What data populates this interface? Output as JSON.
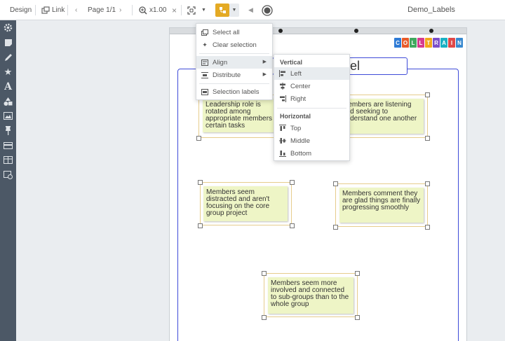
{
  "toolbar": {
    "design_label": "Design",
    "link_label": "Link",
    "page_label": "Page 1/1",
    "zoom_label": "x1.00",
    "doc_title": "Demo_Labels"
  },
  "sidebar": {
    "icons": [
      "gear-icon",
      "note-icon",
      "pen-icon",
      "star-icon",
      "text-icon",
      "shapes-icon",
      "image-icon",
      "pin-icon",
      "card-icon",
      "table-icon",
      "widget-icon"
    ]
  },
  "canvas": {
    "title_fragment": "del",
    "logo_letters": [
      "C",
      "O",
      "L",
      "L",
      "T",
      "R",
      "A",
      "I",
      "N"
    ],
    "logo_colors": [
      "#2e7bd6",
      "#e85b2a",
      "#41a85f",
      "#d63b8f",
      "#f2a81d",
      "#7b4fc9",
      "#1ab0c4",
      "#e04848",
      "#3a8ad0"
    ],
    "notes": [
      {
        "text": "Leadership role is rotated among appropriate members for certain tasks"
      },
      {
        "text": "Members are listening and seeking to understand one another"
      },
      {
        "text": "Members seem distracted and aren't focusing on the core group project"
      },
      {
        "text": "Members comment they are glad things are finally progressing smoothly"
      },
      {
        "text": "Members seem more involved and connected to sub-groups than to the whole group"
      }
    ]
  },
  "menu": {
    "select_all": "Select all",
    "clear_selection": "Clear selection",
    "align": "Align",
    "distribute": "Distribute",
    "selection_labels": "Selection labels"
  },
  "submenu": {
    "vertical_heading": "Vertical",
    "left": "Left",
    "center": "Center",
    "right": "Right",
    "horizontal_heading": "Horizontal",
    "top": "Top",
    "middle": "Middle",
    "bottom": "Bottom"
  },
  "colors": {
    "accent": "#e4aa24",
    "frame": "#3e4bd8",
    "note_bg": "#eef5c6",
    "sidebar_bg": "#4c5866"
  }
}
